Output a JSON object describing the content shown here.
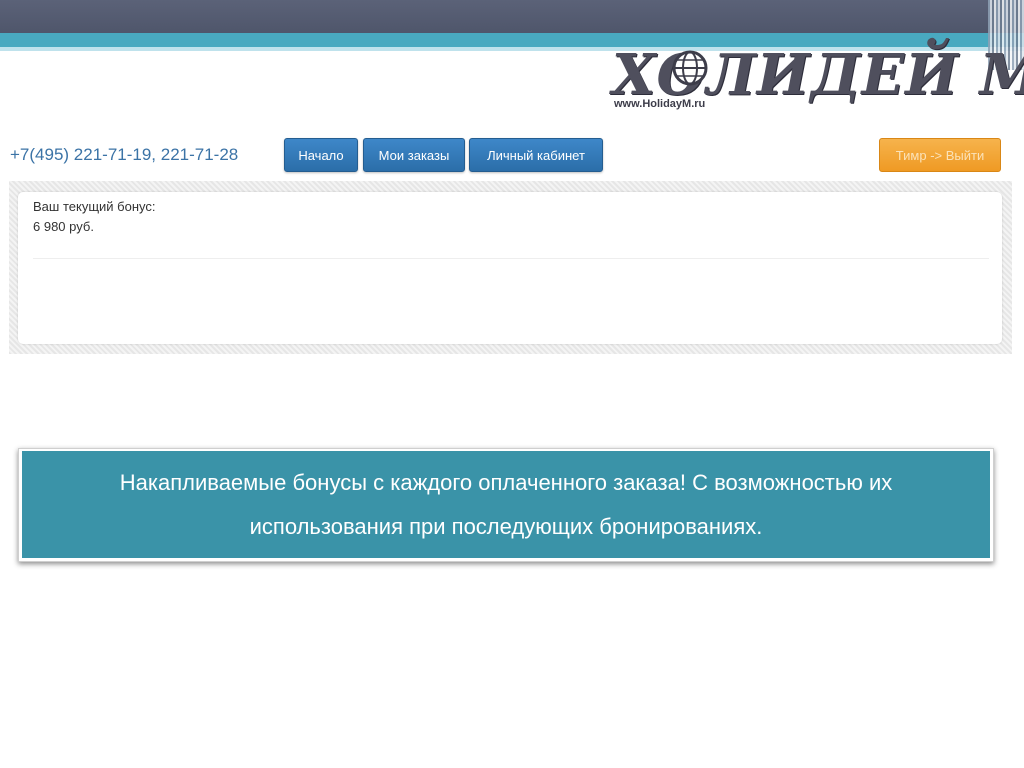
{
  "logo": {
    "text": "ХОЛИДЕЙ М",
    "url": "www.HolidayM.ru",
    "icon": "globe-icon"
  },
  "header": {
    "phone": "+7(495) 221-71-19, 221-71-28",
    "nav": {
      "home": "Начало",
      "orders": "Мои заказы",
      "cabinet": "Личный кабинет"
    },
    "exit": "Тимр -> Выйти"
  },
  "bonus": {
    "label": "Ваш текущий бонус:",
    "value": "6 980 руб."
  },
  "caption": {
    "text": "Накапливаемые бонусы с каждого оплаченного заказа!  С возможностью их использования при последующих бронированиях."
  },
  "colors": {
    "top_dark": "#4f566b",
    "top_teal": "#49a9c0",
    "nav_blue": "#2b6ea9",
    "exit_orange": "#ef9a24",
    "caption_teal": "#3a93a8"
  }
}
